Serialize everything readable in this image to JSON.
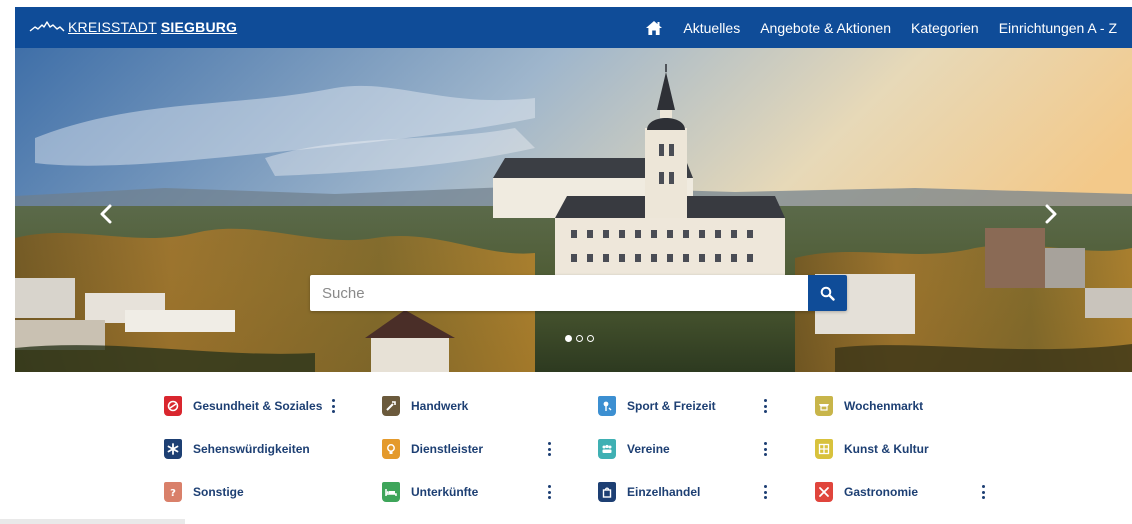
{
  "header": {
    "brand_prefix": "KREISSTADT",
    "brand_name": "SIEGBURG",
    "nav": [
      "Aktuelles",
      "Angebote & Aktionen",
      "Kategorien",
      "Einrichtungen A - Z"
    ],
    "home_icon": "home-icon",
    "bar_color": "#0f4c98"
  },
  "hero": {
    "search_placeholder": "Suche",
    "search_icon": "search-icon",
    "slide_count": 3,
    "active_slide": 1,
    "arrows": [
      "chevron-left-icon",
      "chevron-right-icon"
    ]
  },
  "categories": [
    {
      "label": "Gesundheit & Soziales",
      "color": "#d9262e",
      "icon": "health-icon",
      "has_menu": true
    },
    {
      "label": "Handwerk",
      "color": "#6b5a3c",
      "icon": "tools-icon",
      "has_menu": false
    },
    {
      "label": "Sport & Freizeit",
      "color": "#3c8fd1",
      "icon": "sport-icon",
      "has_menu": true
    },
    {
      "label": "Wochenmarkt",
      "color": "#c8b54a",
      "icon": "market-icon",
      "has_menu": false
    },
    {
      "label": "Sehenswürdigkeiten",
      "color": "#1d3f73",
      "icon": "star-icon",
      "has_menu": false
    },
    {
      "label": "Dienstleister",
      "color": "#e49a2c",
      "icon": "lightbulb-icon",
      "has_menu": true
    },
    {
      "label": "Vereine",
      "color": "#3fb0b3",
      "icon": "group-icon",
      "has_menu": true
    },
    {
      "label": "Kunst & Kultur",
      "color": "#d8c23c",
      "icon": "art-icon",
      "has_menu": false
    },
    {
      "label": "Sonstige",
      "color": "#d9806a",
      "icon": "question-icon",
      "has_menu": false
    },
    {
      "label": "Unterkünfte",
      "color": "#3ea55a",
      "icon": "bed-icon",
      "has_menu": true
    },
    {
      "label": "Einzelhandel",
      "color": "#1d3f73",
      "icon": "bag-icon",
      "has_menu": true
    },
    {
      "label": "Gastronomie",
      "color": "#e0453c",
      "icon": "cutlery-icon",
      "has_menu": true
    }
  ]
}
